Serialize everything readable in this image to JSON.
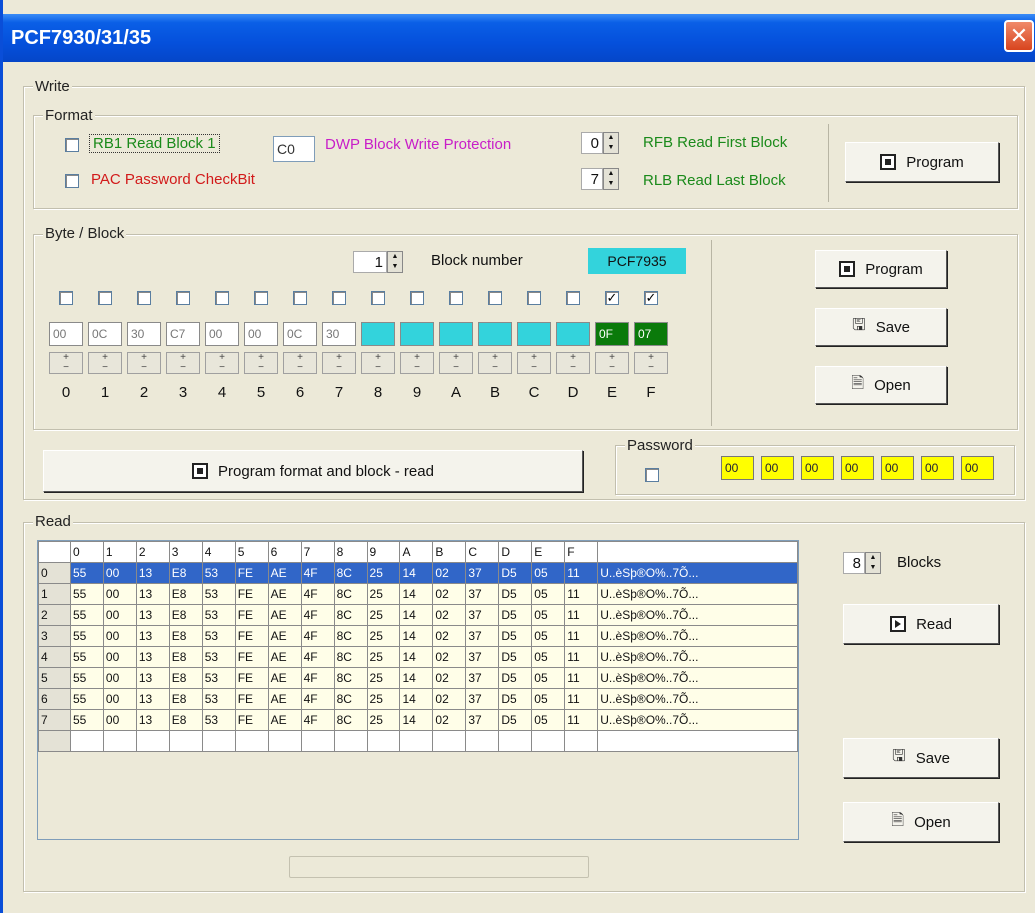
{
  "window": {
    "title": "PCF7930/31/35",
    "close_glyph": "✕"
  },
  "write": {
    "label": "Write",
    "format": {
      "label": "Format",
      "rb1": {
        "label": "RB1 Read Block 1",
        "checked": false,
        "color": "#1a8a1a"
      },
      "pac": {
        "label": "PAC Password CheckBit",
        "checked": false,
        "color": "#d21a1a"
      },
      "dwp": {
        "value": "C0",
        "label": "DWP Block Write Protection",
        "color": "#c81ec8"
      },
      "rfb": {
        "value": "0",
        "label": "RFB Read First Block",
        "color": "#1a8a1a"
      },
      "rlb": {
        "value": "7",
        "label": "RLB Read Last Block",
        "color": "#1a8a1a"
      },
      "program_label": "Program"
    },
    "byte_block": {
      "label": "Byte / Block",
      "block_number": "1",
      "block_number_label": "Block number",
      "chip": "PCF7935",
      "checks": [
        false,
        false,
        false,
        false,
        false,
        false,
        false,
        false,
        false,
        false,
        false,
        false,
        false,
        false,
        true,
        true
      ],
      "values": [
        "00",
        "0C",
        "30",
        "C7",
        "00",
        "00",
        "0C",
        "30",
        "",
        "",
        "",
        "",
        "",
        "",
        "0F",
        "07"
      ],
      "cell_colors": [
        "#ffffff",
        "#ffffff",
        "#ffffff",
        "#ffffff",
        "#ffffff",
        "#ffffff",
        "#ffffff",
        "#ffffff",
        "#33d3dc",
        "#33d3dc",
        "#33d3dc",
        "#33d3dc",
        "#33d3dc",
        "#33d3dc",
        "#0a7a0a",
        "#0a7a0a"
      ],
      "labels": [
        "0",
        "1",
        "2",
        "3",
        "4",
        "5",
        "6",
        "7",
        "8",
        "9",
        "A",
        "B",
        "C",
        "D",
        "E",
        "F"
      ]
    },
    "right_buttons": {
      "program": "Program",
      "save": "Save",
      "open": "Open"
    },
    "program_format_block": "Program format and block - read",
    "password": {
      "label": "Password",
      "checked": false,
      "values": [
        "00",
        "00",
        "00",
        "00",
        "00",
        "00",
        "00"
      ]
    }
  },
  "read": {
    "label": "Read",
    "headers": [
      "0",
      "1",
      "2",
      "3",
      "4",
      "5",
      "6",
      "7",
      "8",
      "9",
      "A",
      "B",
      "C",
      "D",
      "E",
      "F"
    ],
    "rows": [
      {
        "id": "0",
        "selected": true,
        "cells": [
          "55",
          "00",
          "13",
          "E8",
          "53",
          "FE",
          "AE",
          "4F",
          "8C",
          "25",
          "14",
          "02",
          "37",
          "D5",
          "05",
          "11"
        ],
        "ascii": "U..èSþ®O%..7Õ..."
      },
      {
        "id": "1",
        "selected": false,
        "cells": [
          "55",
          "00",
          "13",
          "E8",
          "53",
          "FE",
          "AE",
          "4F",
          "8C",
          "25",
          "14",
          "02",
          "37",
          "D5",
          "05",
          "11"
        ],
        "ascii": "U..èSþ®O%..7Õ..."
      },
      {
        "id": "2",
        "selected": false,
        "cells": [
          "55",
          "00",
          "13",
          "E8",
          "53",
          "FE",
          "AE",
          "4F",
          "8C",
          "25",
          "14",
          "02",
          "37",
          "D5",
          "05",
          "11"
        ],
        "ascii": "U..èSþ®O%..7Õ..."
      },
      {
        "id": "3",
        "selected": false,
        "cells": [
          "55",
          "00",
          "13",
          "E8",
          "53",
          "FE",
          "AE",
          "4F",
          "8C",
          "25",
          "14",
          "02",
          "37",
          "D5",
          "05",
          "11"
        ],
        "ascii": "U..èSþ®O%..7Õ..."
      },
      {
        "id": "4",
        "selected": false,
        "cells": [
          "55",
          "00",
          "13",
          "E8",
          "53",
          "FE",
          "AE",
          "4F",
          "8C",
          "25",
          "14",
          "02",
          "37",
          "D5",
          "05",
          "11"
        ],
        "ascii": "U..èSþ®O%..7Õ..."
      },
      {
        "id": "5",
        "selected": false,
        "cells": [
          "55",
          "00",
          "13",
          "E8",
          "53",
          "FE",
          "AE",
          "4F",
          "8C",
          "25",
          "14",
          "02",
          "37",
          "D5",
          "05",
          "11"
        ],
        "ascii": "U..èSþ®O%..7Õ..."
      },
      {
        "id": "6",
        "selected": false,
        "cells": [
          "55",
          "00",
          "13",
          "E8",
          "53",
          "FE",
          "AE",
          "4F",
          "8C",
          "25",
          "14",
          "02",
          "37",
          "D5",
          "05",
          "11"
        ],
        "ascii": "U..èSþ®O%..7Õ..."
      },
      {
        "id": "7",
        "selected": false,
        "cells": [
          "55",
          "00",
          "13",
          "E8",
          "53",
          "FE",
          "AE",
          "4F",
          "8C",
          "25",
          "14",
          "02",
          "37",
          "D5",
          "05",
          "11"
        ],
        "ascii": "U..èSþ®O%..7Õ..."
      }
    ],
    "blocks_value": "8",
    "blocks_label": "Blocks",
    "read_label": "Read",
    "save_label": "Save",
    "open_label": "Open"
  }
}
